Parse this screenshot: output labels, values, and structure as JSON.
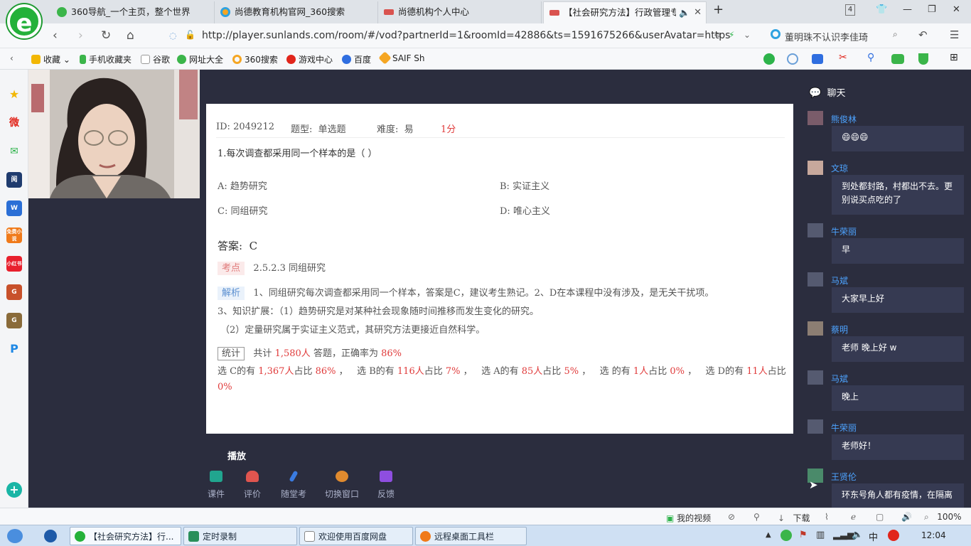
{
  "browser": {
    "tabs": [
      {
        "label": "360导航_一个主页，整个世界"
      },
      {
        "label": "尚德教育机构官网_360搜索"
      },
      {
        "label": "尚德机构个人中心"
      },
      {
        "label": "【社会研究方法】行政管理专"
      }
    ],
    "tab_count": "4",
    "url": "http://player.sunlands.com/room/#/vod?partnerId=1&roomId=42886&ts=1591675266&userAvatar=https",
    "search_text": "董明珠不认识李佳琦"
  },
  "bookmarks": [
    "收藏",
    "手机收藏夹",
    "谷歌",
    "网址大全",
    "360搜索",
    "游戏中心",
    "百度",
    "SAIF Sh"
  ],
  "sidebar_labels": [
    "★",
    "微",
    "✉",
    "阅",
    "W",
    "免费小说",
    "小红书",
    "G",
    "G",
    "P",
    "+"
  ],
  "question": {
    "id_label": "ID:",
    "id": "2049212",
    "type_label": "题型:",
    "type": "单选题",
    "difficulty_label": "难度:",
    "difficulty": "易",
    "score": "1分",
    "text": "1.每次调查都采用同一个样本的是（ ）",
    "options": [
      {
        "label": "A:",
        "text": "趋势研究"
      },
      {
        "label": "B:",
        "text": "实证主义"
      },
      {
        "label": "C:",
        "text": "同组研究"
      },
      {
        "label": "D:",
        "text": "唯心主义"
      }
    ],
    "answer_label": "答案:",
    "answer": "C",
    "point_label": "考点",
    "point": "2.5.2.3 同组研究",
    "analysis_label": "解析",
    "analysis_1": "1、同组研究每次调查都采用同一个样本，答案是C，建议考生熟记。2、D在本课程中没有涉及，是无关干扰项。",
    "analysis_2": "3、知识扩展：（1）趋势研究是对某种社会现象随时间推移而发生变化的研究。",
    "analysis_3": "（2）定量研究属于实证主义范式，其研究方法更接近自然科学。",
    "stats_label": "统计",
    "total_prefix": "共计",
    "total": "1,580人",
    "correct_prefix": "答题，正确率为",
    "correct_rate": "86%",
    "breakdown": [
      {
        "pre": "选 C的有",
        "n": "1,367人",
        "mid": "占比",
        "pct": "86%",
        "post": "，"
      },
      {
        "pre": "选 B的有",
        "n": "116人",
        "mid": "占比",
        "pct": "7%",
        "post": "，"
      },
      {
        "pre": "选 A的有",
        "n": "85人",
        "mid": "占比",
        "pct": "5%",
        "post": "，"
      },
      {
        "pre": "选 的有",
        "n": "1人",
        "mid": "占比",
        "pct": "0%",
        "post": "，"
      },
      {
        "pre": "选 D的有",
        "n": "11人",
        "mid": "占比",
        "pct": "0%",
        "post": ""
      }
    ]
  },
  "controls": {
    "play": "播放",
    "tools": [
      "课件",
      "评价",
      "随堂考",
      "切换窗口",
      "反馈"
    ]
  },
  "chat": {
    "title": "聊天",
    "messages": [
      {
        "name": "熊俊林",
        "text": "😄😄😄"
      },
      {
        "name": "文琼",
        "text": "到处都封路，村都出不去。更别说买点吃的了"
      },
      {
        "name": "牛荣丽",
        "text": "早"
      },
      {
        "name": "马斌",
        "text": "大家早上好"
      },
      {
        "name": "蔡明",
        "text": "老师 晚上好 w"
      },
      {
        "name": "马斌",
        "text": "晚上"
      },
      {
        "name": "牛荣丽",
        "text": "老师好！"
      },
      {
        "name": "王贤伦",
        "text": "环东号角人都有疫情，在隔离"
      }
    ]
  },
  "status": {
    "my_video": "我的视频",
    "download": "下载",
    "zoom": "100%"
  },
  "taskbar": {
    "items": [
      "【社会研究方法】行...",
      "定时录制",
      "欢迎使用百度网盘",
      "远程桌面工具栏"
    ],
    "ime": "中",
    "clock": "12:04"
  },
  "colors": {
    "accent_red": "#e03b3b",
    "chat_name": "#4da3ff",
    "player_bg": "#2b2d3e"
  }
}
